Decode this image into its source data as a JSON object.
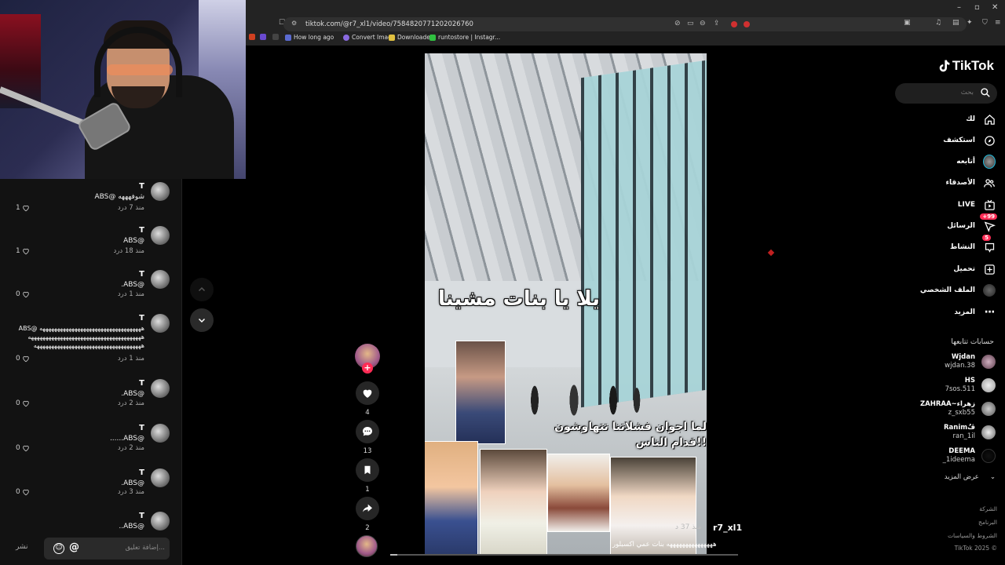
{
  "browser": {
    "url": "tiktok.com/@r7_xl1/video/7584820771202026760",
    "bookmarks": [
      "How long ago",
      "Convert Image",
      "Downloader",
      "runtostore | Instagr..."
    ],
    "window_controls": [
      "–",
      "▫",
      "✕"
    ]
  },
  "comments": {
    "items": [
      {
        "user": "T",
        "text": "ABS@ شوفهههه",
        "meta": "منذ 7 د",
        "reply": "رد",
        "likes": "1"
      },
      {
        "user": "T",
        "text": "ABS@",
        "meta": "منذ 18 د",
        "reply": "رد",
        "likes": "1"
      },
      {
        "user": "T",
        "text": ".ABS@",
        "meta": "منذ 1 د",
        "reply": "رد",
        "likes": "0"
      },
      {
        "user": "T",
        "text": "ABS@ هههههههههههههههههههههههههههههههههههه\nهههههههههههههههههههههههههههههههههههههههه\nهههههههههههههههههههههههههههههههههههههه",
        "meta": "منذ 1 د",
        "reply": "رد",
        "likes": "0"
      },
      {
        "user": "T",
        "text": ".ABS@",
        "meta": "منذ 2 د",
        "reply": "رد",
        "likes": "0"
      },
      {
        "user": "T",
        "text": "......ABS@",
        "meta": "منذ 2 د",
        "reply": "رد",
        "likes": "0"
      },
      {
        "user": "T",
        "text": ".ABS@",
        "meta": "منذ 3 د",
        "reply": "رد",
        "likes": "0"
      },
      {
        "user": "T",
        "text": "..ABS@",
        "meta": "",
        "reply": "",
        "likes": ""
      }
    ],
    "input_placeholder": "إضافة تعليق...",
    "share_label": "نشر"
  },
  "video": {
    "overlay_title": "يلا يا بنات مشينا",
    "overlay_caption": "لما اجوان فشلاتنا تتهاوشون قدام الناس!!",
    "author": "r7_xl1",
    "time": "منذ 37 د",
    "description": "هههههههههههههههه بنات عمي اكسبلور",
    "progress": 0.02
  },
  "actions": {
    "likes": "4",
    "comments": "13",
    "saves": "1",
    "shares": "2"
  },
  "sidebar": {
    "logo": "TikTok",
    "search_placeholder": "بحث",
    "nav": [
      {
        "label": "لك",
        "icon": "home-icon"
      },
      {
        "label": "استكشف",
        "icon": "compass-icon"
      },
      {
        "label": "أتابعه",
        "icon": "following-icon"
      },
      {
        "label": "الأصدقاء",
        "icon": "friends-icon"
      },
      {
        "label": "LIVE",
        "icon": "live-icon"
      },
      {
        "label": "الرسائل",
        "icon": "messages-icon",
        "badge": "+99"
      },
      {
        "label": "النشاط",
        "icon": "activity-icon",
        "badge": "5"
      },
      {
        "label": "تحميل",
        "icon": "upload-icon"
      },
      {
        "label": "الملف الشخصي",
        "icon": "profile-icon"
      },
      {
        "label": "المزيد",
        "icon": "more-icon"
      }
    ],
    "following_title": "حسابات تتابعها",
    "following": [
      {
        "name": "Wjdan",
        "handle": "wjdan.38"
      },
      {
        "name": "HS",
        "handle": "7sos.511"
      },
      {
        "name": "ZAHRAA~زهراء",
        "handle": "z_sxb55"
      },
      {
        "name": "Ranimڤُُ",
        "handle": "ran_1il"
      },
      {
        "name": "DEEMA",
        "handle": "_1ideema"
      }
    ],
    "see_more": "عرض المزيد",
    "footer": [
      "الشركة",
      "البرنامج",
      "الشروط والسياسات",
      "TikTok 2025 ©"
    ]
  },
  "colors": {
    "accent": "#fe2c55",
    "background": "#000000"
  }
}
